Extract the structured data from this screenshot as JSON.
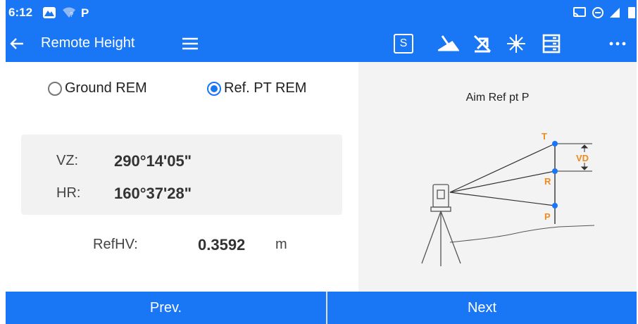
{
  "status_bar": {
    "time": "6:12"
  },
  "app_bar": {
    "title": "Remote Height",
    "s_label": "S"
  },
  "modes": [
    {
      "label": "Ground REM",
      "selected": false
    },
    {
      "label": "Ref. PT REM",
      "selected": true
    }
  ],
  "angles": {
    "vz_label": "VZ:",
    "vz_value": "290°14'05\"",
    "hr_label": "HR:",
    "hr_value": "160°37'28\""
  },
  "refhv": {
    "label": "RefHV:",
    "value": "0.3592",
    "unit": "m"
  },
  "diagram": {
    "caption": "Aim Ref pt P",
    "point_t": "T",
    "point_r": "R",
    "point_p": "P",
    "vd_label": "VD",
    "point_color": "#1976f5",
    "label_color": "#f08a1e"
  },
  "buttons": {
    "prev": "Prev.",
    "next": "Next"
  },
  "colors": {
    "accent": "#1976f5",
    "panel": "#f3f3f3"
  }
}
